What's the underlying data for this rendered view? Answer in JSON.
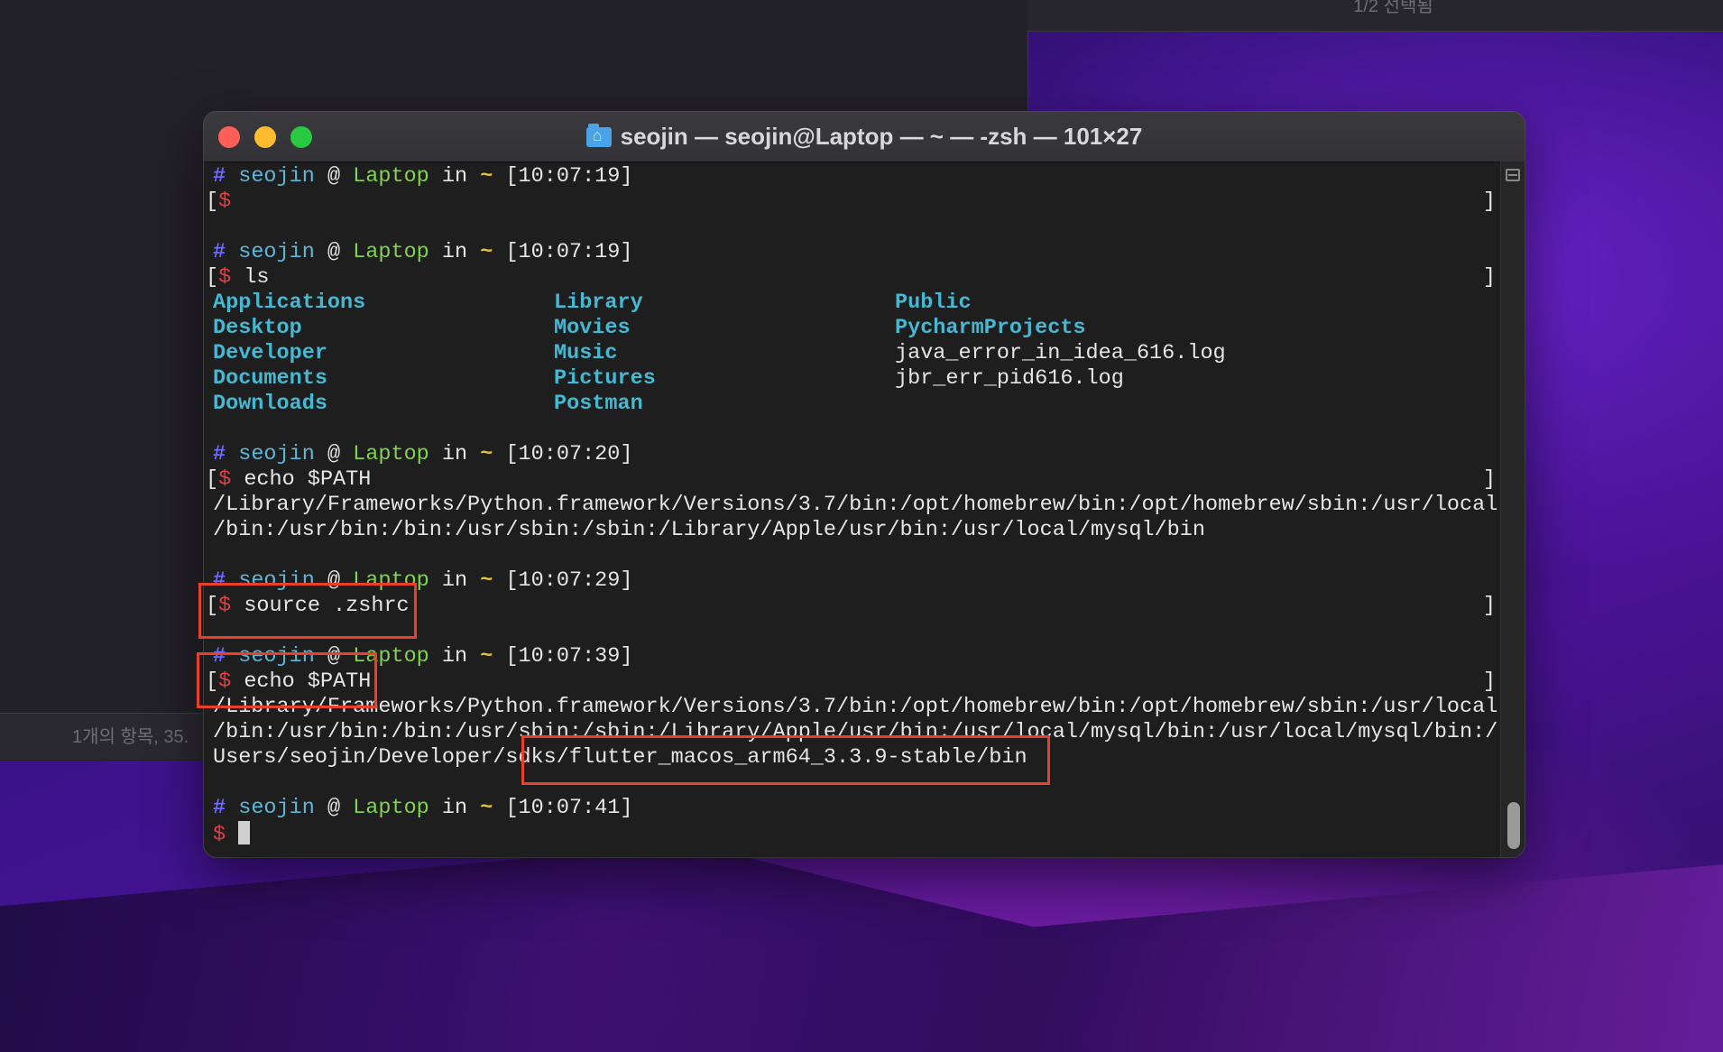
{
  "background": {
    "right_window_status": "1/2 선택됨",
    "left_window_status": "1개의 항목, 35."
  },
  "terminal": {
    "title": "seojin — seojin@Laptop — ~ — -zsh — 101×27",
    "prompt": {
      "hash": "#",
      "user": "seojin",
      "at": "@",
      "host": "Laptop",
      "in": "in",
      "dir": "~",
      "dollar": "$"
    },
    "blocks": [
      {
        "time": "[10:07:19]",
        "command": ""
      },
      {
        "time": "[10:07:19]",
        "command": "ls"
      },
      {
        "time": "[10:07:20]",
        "command": "echo $PATH"
      },
      {
        "time": "[10:07:29]",
        "command": "source .zshrc"
      },
      {
        "time": "[10:07:39]",
        "command": "echo $PATH"
      },
      {
        "time": "[10:07:41]",
        "command": ""
      }
    ],
    "ls_output": {
      "col1": [
        "Applications",
        "Desktop",
        "Developer",
        "Documents",
        "Downloads"
      ],
      "col2": [
        "Library",
        "Movies",
        "Music",
        "Pictures",
        "Postman"
      ],
      "col3_dirs": [
        "Public",
        "PycharmProjects"
      ],
      "col3_files": [
        "java_error_in_idea_616.log",
        "jbr_err_pid616.log"
      ]
    },
    "path_output_1": [
      "/Library/Frameworks/Python.framework/Versions/3.7/bin:/opt/homebrew/bin:/opt/homebrew/sbin:/usr/local",
      "/bin:/usr/bin:/bin:/usr/sbin:/sbin:/Library/Apple/usr/bin:/usr/local/mysql/bin"
    ],
    "path_output_2": [
      "/Library/Frameworks/Python.framework/Versions/3.7/bin:/opt/homebrew/bin:/opt/homebrew/sbin:/usr/local",
      "/bin:/usr/bin:/bin:/usr/sbin:/sbin:/Library/Apple/usr/bin:/usr/local/mysql/bin:/usr/local/mysql/bin:/",
      "Users/seojin/Developer/sdks/flutter_macos_arm64_3.3.9-stable/bin"
    ],
    "annotation_color": "#e8402a"
  }
}
